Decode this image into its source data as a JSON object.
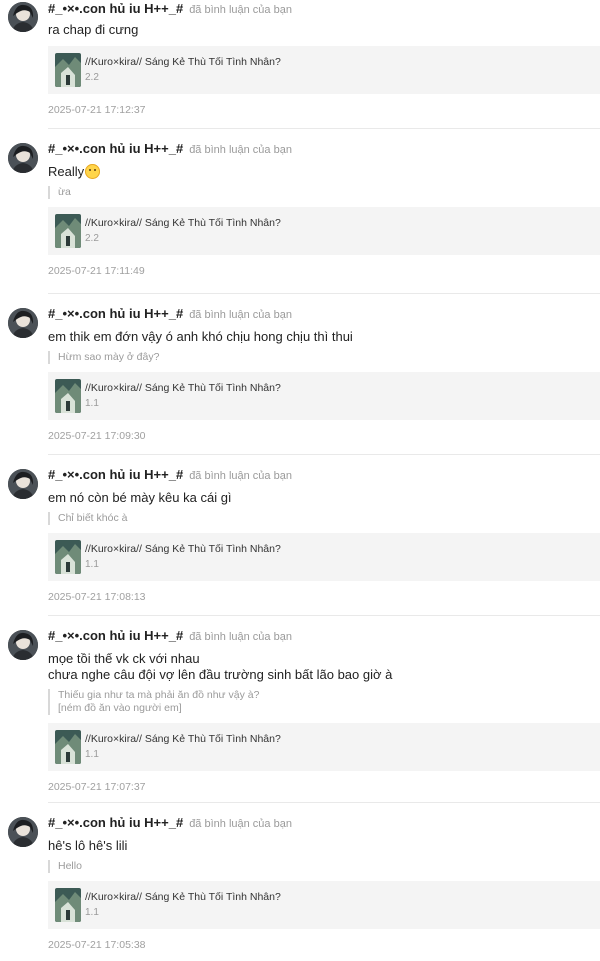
{
  "notifications": [
    {
      "user": "#_•×•.con hủ iu H++_#",
      "action": "đã bình luận của bạn",
      "message": "ra chap đi cưng",
      "quote": "",
      "has_emoji": false,
      "card": {
        "title": "//Kuro×kira// Sáng Kẻ Thù Tối Tình Nhân?",
        "chapter": "2.2"
      },
      "time": "2025-07-21 17:12:37"
    },
    {
      "user": "#_•×•.con hủ iu H++_#",
      "action": "đã bình luận của bạn",
      "message": "Really",
      "quote": "ừa",
      "has_emoji": true,
      "card": {
        "title": "//Kuro×kira// Sáng Kẻ Thù Tối Tình Nhân?",
        "chapter": "2.2"
      },
      "time": "2025-07-21 17:11:49"
    },
    {
      "user": "#_•×•.con hủ iu H++_#",
      "action": "đã bình luận của bạn",
      "message": "em thik em đớn vậy ó anh khó chịu hong chịu thì thui",
      "quote": "Hừm sao mày ở đây?",
      "has_emoji": false,
      "card": {
        "title": "//Kuro×kira// Sáng Kẻ Thù Tối Tình Nhân?",
        "chapter": "1.1"
      },
      "time": "2025-07-21 17:09:30"
    },
    {
      "user": "#_•×•.con hủ iu H++_#",
      "action": "đã bình luận của bạn",
      "message": "em nó còn bé mày kêu ka cái gì",
      "quote": "Chỉ biết khóc à",
      "has_emoji": false,
      "card": {
        "title": "//Kuro×kira// Sáng Kẻ Thù Tối Tình Nhân?",
        "chapter": "1.1"
      },
      "time": "2025-07-21 17:08:13"
    },
    {
      "user": "#_•×•.con hủ iu H++_#",
      "action": "đã bình luận của bạn",
      "message": "mọe tồi thế vk ck với nhau\nchưa nghe câu đội vợ lên đầu trường sinh bất lão bao giờ à",
      "quote": "Thiếu gia như ta mà phải ăn đồ như vậy à?\n[ném đồ ăn vào người em]",
      "has_emoji": false,
      "card": {
        "title": "//Kuro×kira// Sáng Kẻ Thù Tối Tình Nhân?",
        "chapter": "1.1"
      },
      "time": "2025-07-21 17:07:37"
    },
    {
      "user": "#_•×•.con hủ iu H++_#",
      "action": "đã bình luận của bạn",
      "message": "hê's lô hê's lili",
      "quote": "Hello",
      "has_emoji": false,
      "card": {
        "title": "//Kuro×kira// Sáng Kẻ Thù Tối Tình Nhân?",
        "chapter": "1.1"
      },
      "time": "2025-07-21 17:05:38"
    }
  ]
}
